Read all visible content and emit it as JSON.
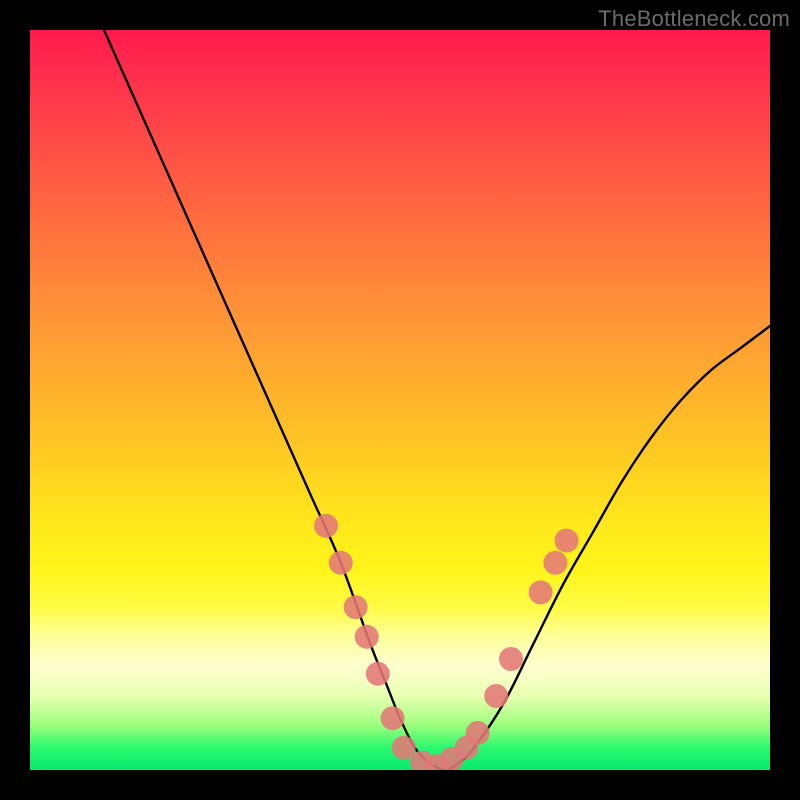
{
  "watermark": "TheBottleneck.com",
  "colors": {
    "frame": "#000000",
    "curve_stroke": "#000000",
    "marker_fill": "#e47878",
    "marker_alpha": 0.88
  },
  "chart_data": {
    "type": "line",
    "title": "",
    "xlabel": "",
    "ylabel": "",
    "xlim": [
      0,
      100
    ],
    "ylim": [
      0,
      100
    ],
    "curve": {
      "x": [
        10,
        14,
        18,
        22,
        26,
        30,
        34,
        38,
        42,
        46,
        48,
        50,
        52,
        54,
        56,
        58,
        60,
        64,
        68,
        72,
        76,
        80,
        84,
        88,
        92,
        96,
        100
      ],
      "y": [
        100,
        91,
        82,
        73,
        64,
        55,
        46,
        37,
        28,
        17,
        12,
        7,
        3,
        1,
        0,
        1,
        3,
        9,
        17,
        25,
        32,
        39,
        45,
        50,
        54,
        57,
        60
      ]
    },
    "markers": [
      {
        "x": 40,
        "y": 33
      },
      {
        "x": 42,
        "y": 28
      },
      {
        "x": 44,
        "y": 22
      },
      {
        "x": 45.5,
        "y": 18
      },
      {
        "x": 47,
        "y": 13
      },
      {
        "x": 49,
        "y": 7
      },
      {
        "x": 50.5,
        "y": 3
      },
      {
        "x": 53,
        "y": 1
      },
      {
        "x": 55,
        "y": 0.5
      },
      {
        "x": 57,
        "y": 1.5
      },
      {
        "x": 59,
        "y": 3
      },
      {
        "x": 60.5,
        "y": 5
      },
      {
        "x": 63,
        "y": 10
      },
      {
        "x": 65,
        "y": 15
      },
      {
        "x": 69,
        "y": 24
      },
      {
        "x": 71,
        "y": 28
      },
      {
        "x": 72.5,
        "y": 31
      }
    ]
  }
}
